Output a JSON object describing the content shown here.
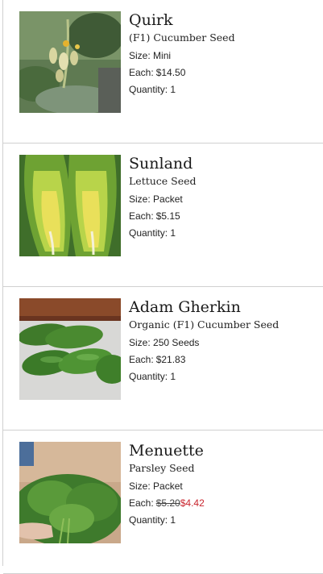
{
  "cart": {
    "items": [
      {
        "name": "Quirk",
        "subtitle": "(F1) Cucumber Seed",
        "size_label": "Size:",
        "size": "Mini",
        "each_label": "Each:",
        "price": "$14.50",
        "qty_label": "Quantity:",
        "quantity": "1",
        "image": "cucumber-vine-photo"
      },
      {
        "name": "Sunland",
        "subtitle": "Lettuce Seed",
        "size_label": "Size:",
        "size": "Packet",
        "each_label": "Each:",
        "price": "$5.15",
        "qty_label": "Quantity:",
        "quantity": "1",
        "image": "romaine-lettuce-photo"
      },
      {
        "name": "Adam Gherkin",
        "subtitle": "Organic (F1) Cucumber Seed",
        "size_label": "Size:",
        "size": "250 Seeds",
        "each_label": "Each:",
        "price": "$21.83",
        "qty_label": "Quantity:",
        "quantity": "1",
        "image": "gherkin-cucumbers-photo"
      },
      {
        "name": "Menuette",
        "subtitle": "Parsley Seed",
        "size_label": "Size:",
        "size": "Packet",
        "each_label": "Each:",
        "original_price": "$5.20",
        "sale_price": "$4.42",
        "qty_label": "Quantity:",
        "quantity": "1",
        "image": "parsley-bunch-photo"
      }
    ]
  },
  "colors": {
    "sale_price": "#c8242d",
    "divider": "#d0d0d0"
  }
}
